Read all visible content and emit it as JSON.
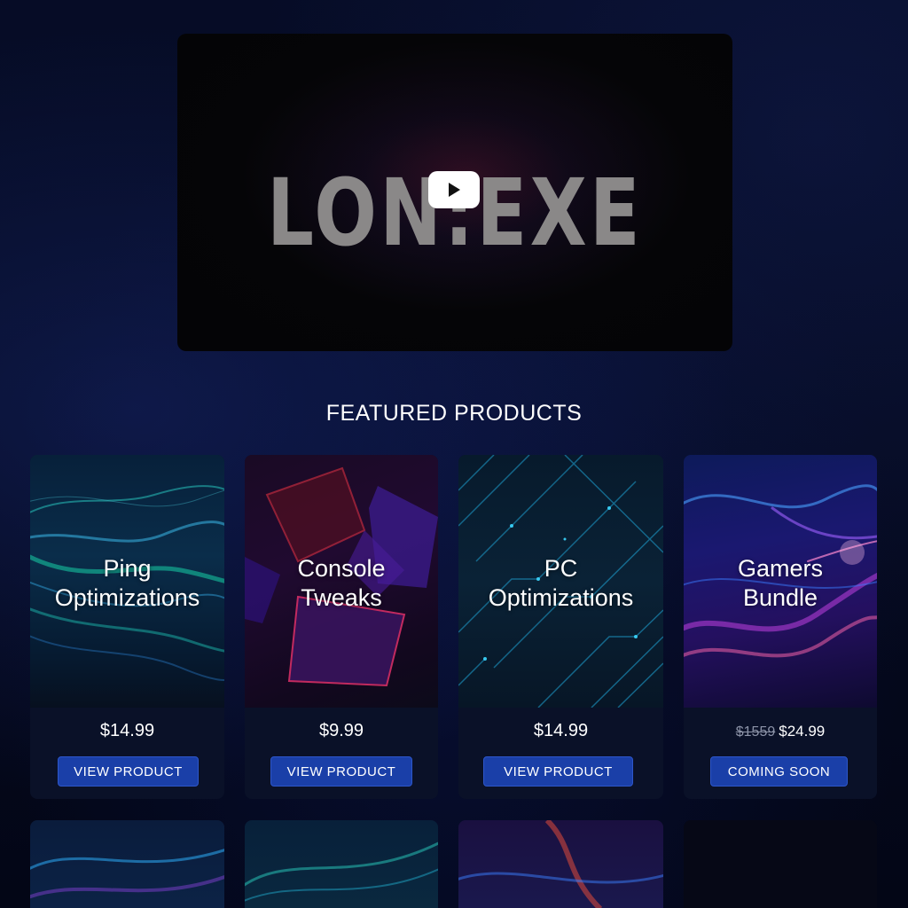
{
  "video": {
    "title_text": "LON:EXE",
    "play_icon": "play-icon"
  },
  "section": {
    "title": "FEATURED PRODUCTS"
  },
  "products": [
    {
      "name_line1": "Ping",
      "name_line2": "Optimizations",
      "price": "$14.99",
      "button_label": "VIEW PRODUCT"
    },
    {
      "name_line1": "Console",
      "name_line2": "Tweaks",
      "price": "$9.99",
      "button_label": "VIEW PRODUCT"
    },
    {
      "name_line1": "PC",
      "name_line2": "Optimizations",
      "price": "$14.99",
      "button_label": "VIEW PRODUCT"
    },
    {
      "name_line1": "Gamers",
      "name_line2": "Bundle",
      "old_price": "$1559",
      "price": "$24.99",
      "button_label": "COMING SOON"
    }
  ],
  "colors": {
    "button_bg": "#1a3fa8",
    "page_bg": "#04081c",
    "card_bg": "#0a1128"
  }
}
